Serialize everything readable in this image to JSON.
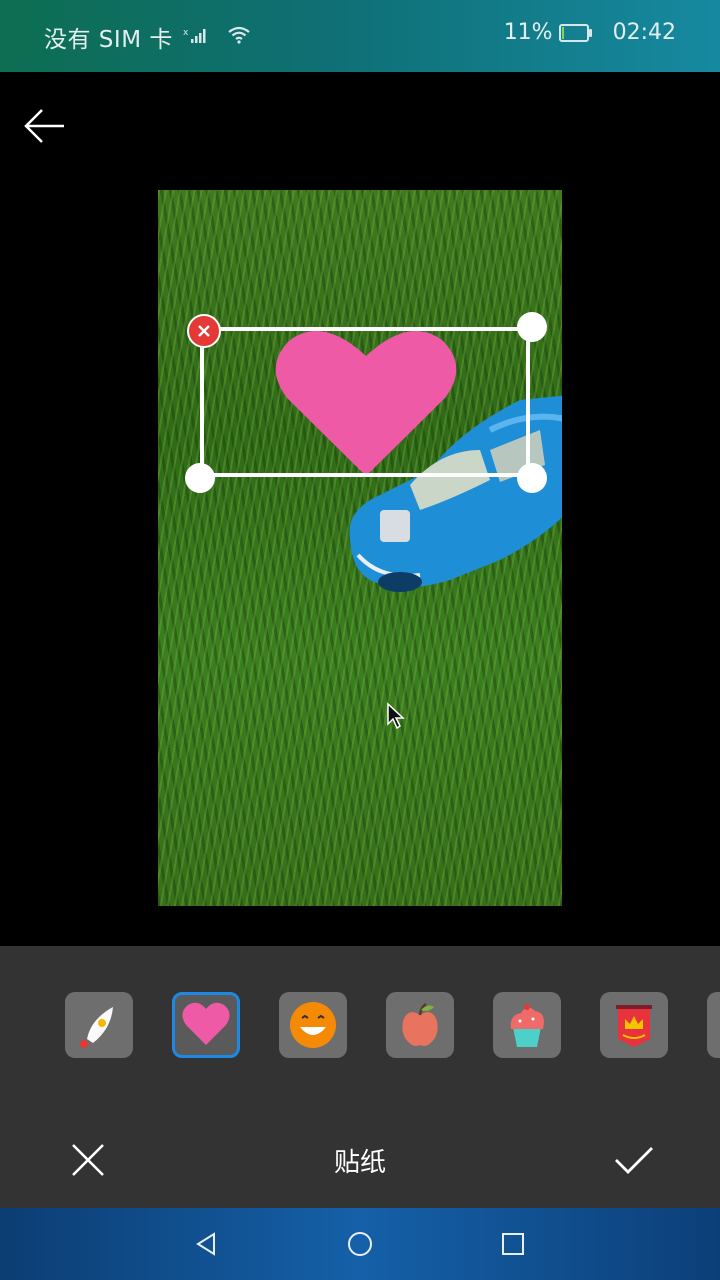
{
  "status_bar": {
    "sim_text": "没有 SIM 卡",
    "battery_percent": "11%",
    "battery_level": 0.11,
    "time": "02:42"
  },
  "header": {
    "back_icon": "arrow-left-icon"
  },
  "editor": {
    "sticker_selected": "heart",
    "sticker_color": "#ee5aa6",
    "delete_icon": "close-icon",
    "delete_color": "#e53935"
  },
  "sticker_strip": {
    "items": [
      {
        "name": "rocket",
        "selected": false
      },
      {
        "name": "heart",
        "selected": true
      },
      {
        "name": "smiley",
        "selected": false
      },
      {
        "name": "apple",
        "selected": false
      },
      {
        "name": "cupcake",
        "selected": false
      },
      {
        "name": "crown-banner",
        "selected": false
      },
      {
        "name": "partial-sticker",
        "selected": false
      }
    ],
    "selected_border_color": "#1e88e5"
  },
  "action_bar": {
    "title": "贴纸",
    "cancel_icon": "close-icon",
    "confirm_icon": "check-icon"
  },
  "nav_bar": {
    "icons": [
      "back-triangle-icon",
      "home-circle-icon",
      "recents-square-icon"
    ]
  }
}
